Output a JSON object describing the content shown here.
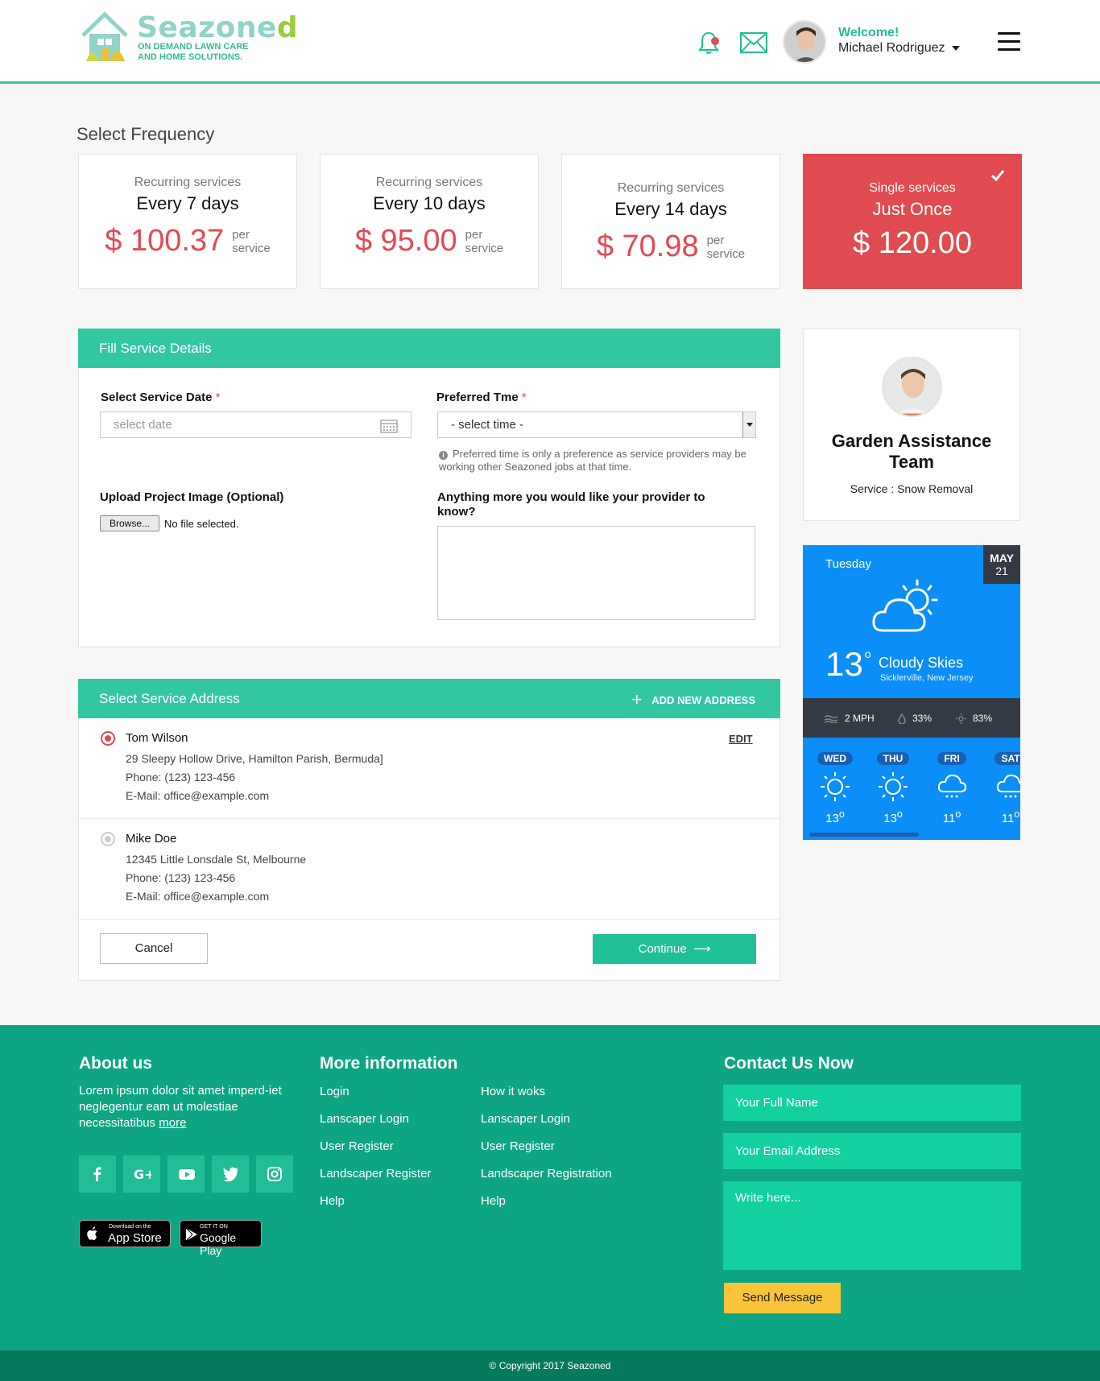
{
  "brand": {
    "name_main": "Seazone",
    "name_accent": "d",
    "tagline_line1": "ON DEMAND LAWN CARE",
    "tagline_line2": "AND HOME SOLUTIONS.",
    "colors": {
      "teal": "#33c6a3",
      "red": "#e24a50",
      "green_footer": "#0ea584",
      "blue_weather": "#0b8ef7"
    }
  },
  "header": {
    "welcome": "Welcome!",
    "user_name": "Michael Rodriguez",
    "icons": [
      "bell-icon",
      "mail-icon",
      "menu-icon"
    ]
  },
  "frequency": {
    "title": "Select Frequency",
    "cards": [
      {
        "sub": "Recurring services",
        "label": "Every 7 days",
        "price": "$ 100.37",
        "per_line1": "per",
        "per_line2": "service",
        "selected": false
      },
      {
        "sub": "Recurring services",
        "label": "Every 10 days",
        "price": "$ 95.00",
        "per_line1": "per",
        "per_line2": "service",
        "selected": false
      },
      {
        "sub": "Recurring services",
        "label": "Every 14 days",
        "price": "$ 70.98",
        "per_line1": "per",
        "per_line2": "service",
        "selected": false
      },
      {
        "sub": "Single services",
        "label": "Just Once",
        "price": "$ 120.00",
        "selected": true
      }
    ]
  },
  "service_details": {
    "title": "Fill Service Details",
    "date_label": "Select Service Date",
    "required_mark": "*",
    "date_placeholder": "select date",
    "time_label": "Preferred Tme",
    "time_value": "- select time -",
    "time_note": "Preferred time is only a preference as service providers may be working other Seazoned jobs at that time.",
    "upload_label": "Upload Project Image (Optional)",
    "browse_label": "Browse...",
    "no_file": "No file selected.",
    "notes_label": "Anything more you would like your provider to know?"
  },
  "address": {
    "title": "Select Service Address",
    "add_new": "ADD NEW ADDRESS",
    "edit": "EDIT",
    "items": [
      {
        "name": "Tom Wilson",
        "street": "29 Sleepy Hollow Drive, Hamilton Parish, Bermuda]",
        "phone": "Phone: (123) 123-456",
        "email": "E-Mail: office@example.com",
        "selected": true
      },
      {
        "name": "Mike Doe",
        "street": "12345 Little Lonsdale St, Melbourne",
        "phone": "Phone: (123) 123-456",
        "email": "E-Mail: office@example.com",
        "selected": false
      }
    ],
    "cancel": "Cancel",
    "continue": "Continue"
  },
  "provider": {
    "name": "Garden Assistance Team",
    "service": "Service : Snow Removal"
  },
  "weather": {
    "day": "Tuesday",
    "month": "MAY",
    "date": "21",
    "temp": "13",
    "degree": "o",
    "condition": "Cloudy Skies",
    "location": "Sicklerville, New Jersey",
    "wind": "2 MPH",
    "precip": "33%",
    "humidity": "83%",
    "forecast": [
      {
        "day": "WED",
        "temp": "13",
        "icon": "sun-icon"
      },
      {
        "day": "THU",
        "temp": "13",
        "icon": "sun-icon"
      },
      {
        "day": "FRI",
        "temp": "11",
        "icon": "snow-cloud-icon"
      },
      {
        "day": "SAT",
        "temp": "11",
        "icon": "snow-cloud-icon"
      }
    ]
  },
  "footer": {
    "about_title": "About us",
    "about_text": "Lorem ipsum dolor sit amet imperd-iet neglegentur eam ut molestiae necessitatibus",
    "about_more": "more",
    "more_title": "More information",
    "links_col1": [
      "Login",
      "Lanscaper Login",
      "User Register",
      "Landscaper Register",
      "Help"
    ],
    "links_col2": [
      "How it woks",
      "Lanscaper Login",
      "User Register",
      "Landscaper Registration",
      "Help"
    ],
    "app_store_small": "Download on the",
    "app_store": "App Store",
    "google_small": "GET IT ON",
    "google_play": "Google Play",
    "contact_title": "Contact Us Now",
    "name_placeholder": "Your Full Name",
    "email_placeholder": "Your Email Address",
    "message_placeholder": "Write here...",
    "send": "Send Message",
    "copyright": "© Copyright 2017 Seazoned"
  }
}
